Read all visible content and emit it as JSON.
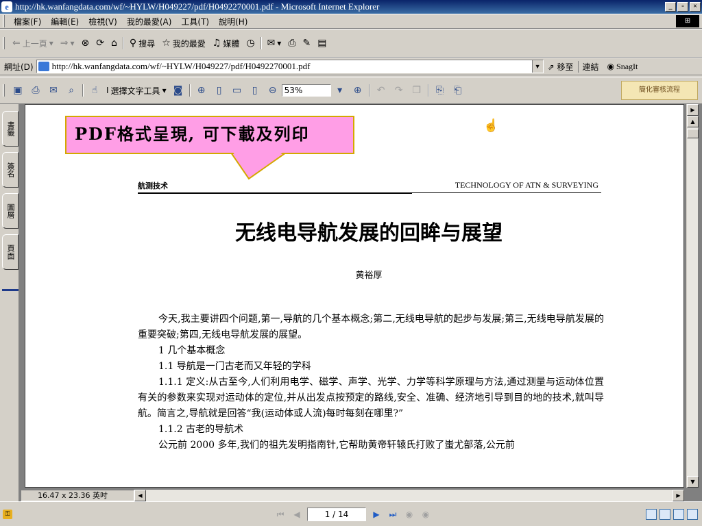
{
  "window": {
    "title": "http://hk.wanfangdata.com/wf/~HYLW/H049227/pdf/H0492270001.pdf - Microsoft Internet Explorer",
    "min_glyph": "_",
    "max_glyph": "▫",
    "close_glyph": "×"
  },
  "menu": {
    "items": [
      "檔案(F)",
      "編輯(E)",
      "檢視(V)",
      "我的最愛(A)",
      "工具(T)",
      "說明(H)"
    ]
  },
  "toolbar": {
    "back_label": "上一頁",
    "search_label": "搜尋",
    "favorites_label": "我的最愛",
    "media_label": "媒體"
  },
  "address": {
    "label": "網址(D)",
    "url": "http://hk.wanfangdata.com/wf/~HYLW/H049227/pdf/H0492270001.pdf",
    "go_label": "移至",
    "links_label": "連結",
    "snagit_label": "SnagIt"
  },
  "pdf_toolbar": {
    "select_tool_label": "選擇文字工具",
    "zoom_value": "53%",
    "workflow_label": "簡化審核流程"
  },
  "nav_tabs": [
    "書籤",
    "簽名",
    "圖層",
    "頁面"
  ],
  "document": {
    "callout": "PDF格式呈現, 可下載及列印",
    "journal_left": "航测技术",
    "journal_right": "TECHNOLOGY OF ATN & SURVEYING",
    "title": "无线电导航发展的回眸与展望",
    "author": "黄裕厚",
    "paragraphs": [
      "今天,我主要讲四个问题,第一,导航的几个基本概念;第二,无线电导航的起步与发展;第三,无线电导航发展的重要突破;第四,无线电导航发展的展望。",
      "1  几个基本概念",
      "1.1  导航是一门古老而又年轻的学科",
      "1.1.1  定义:从古至今,人们利用电学、磁学、声学、光学、力学等科学原理与方法,通过测量与运动体位置有关的参数来实现对运动体的定位,并从出发点按预定的路线,安全、准确、经济地引导到目的地的技术,就叫导航。简言之,导航就是回答“我(运动体或人流)每时每刻在哪里?”",
      "1.1.2  古老的导航术",
      "公元前 2000 多年,我们的祖先发明指南针,它帮助黄帝轩辕氏打败了蚩尤部落,公元前"
    ],
    "page_size": "16.47 x 23.36 英吋"
  },
  "status": {
    "page_indicator": "1 / 14"
  }
}
